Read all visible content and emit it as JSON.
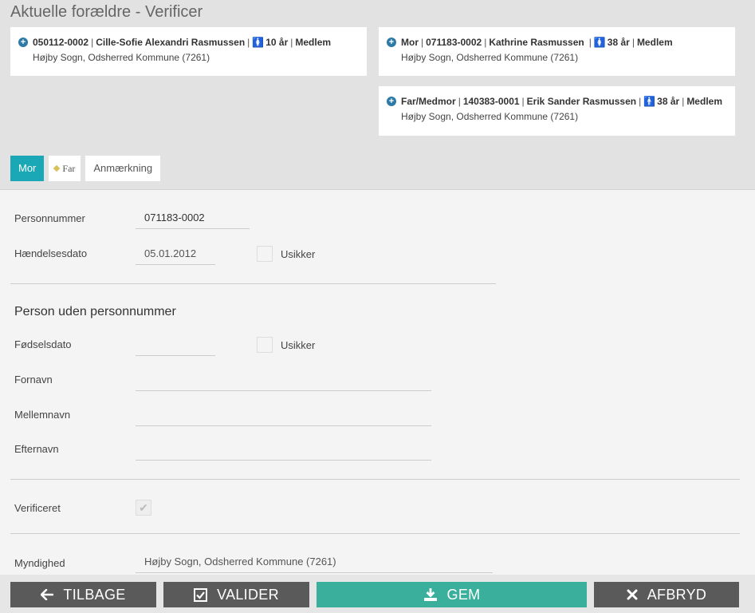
{
  "header": {
    "title": "Aktuelle forældre - Verificer"
  },
  "child_card": {
    "cpr": "050112-0002",
    "name": "Cille-Sofie Alexandri Rasmussen",
    "age": "10 år",
    "status": "Medlem",
    "location": "Højby Sogn, Odsherred Kommune (7261)"
  },
  "mother_card": {
    "role": "Mor",
    "cpr": "071183-0002",
    "name": "Kathrine Rasmussen",
    "age": "38 år",
    "status": "Medlem",
    "location": "Højby Sogn, Odsherred Kommune (7261)"
  },
  "father_card": {
    "role": "Far/Medmor",
    "cpr": "140383-0001",
    "name": "Erik Sander Rasmussen",
    "age": "38 år",
    "status": "Medlem",
    "location": "Højby Sogn, Odsherred Kommune (7261)"
  },
  "tabs": [
    {
      "label": "Mor",
      "active": true
    },
    {
      "label": "Far",
      "active": false
    },
    {
      "label": "Anmærkning",
      "active": false
    }
  ],
  "form": {
    "personnummer_label": "Personnummer",
    "personnummer_value": "071183-0002",
    "haendelsesdato_label": "Hændelsesdato",
    "haendelsesdato_value": "05.01.2012",
    "usikker_label": "Usikker",
    "section_title": "Person uden personnummer",
    "foedselsdato_label": "Fødselsdato",
    "foedselsdato_value": "",
    "usikker2_label": "Usikker",
    "fornavn_label": "Fornavn",
    "fornavn_value": "",
    "mellemnavn_label": "Mellemnavn",
    "mellemnavn_value": "",
    "efternavn_label": "Efternavn",
    "efternavn_value": "",
    "verificeret_label": "Verificeret",
    "verificeret_checked": true,
    "myndighed_label": "Myndighed",
    "myndighed_value": "Højby Sogn, Odsherred Kommune (7261)"
  },
  "buttons": {
    "back": "TILBAGE",
    "validate": "VALIDER",
    "save": "GEM",
    "cancel": "AFBRYD"
  },
  "colors": {
    "accent": "#1aa8b6",
    "save": "#3aaf9b",
    "dark_button": "#5a5a5a",
    "female_icon": "#d9541e",
    "male_icon": "#1e7fb8"
  }
}
